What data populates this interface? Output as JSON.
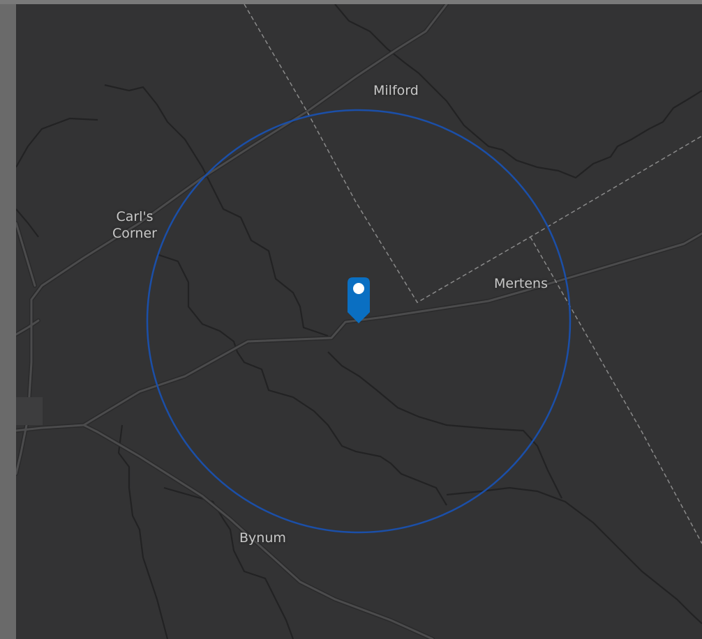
{
  "map": {
    "places": {
      "milford": "Milford",
      "carls_corner": "Carl's\nCorner",
      "mertens": "Mertens",
      "bynum": "Bynum"
    },
    "colors": {
      "background": "#333334",
      "road": "#4a4a4b",
      "road_casing": "#2a2a2b",
      "stream": "#232324",
      "boundary": "#8a8a8a",
      "radius_circle": "#1b4fa8",
      "marker": "#0a6fc2",
      "marker_dot": "#ffffff"
    },
    "marker": {
      "icon": "map-pin-icon"
    }
  }
}
